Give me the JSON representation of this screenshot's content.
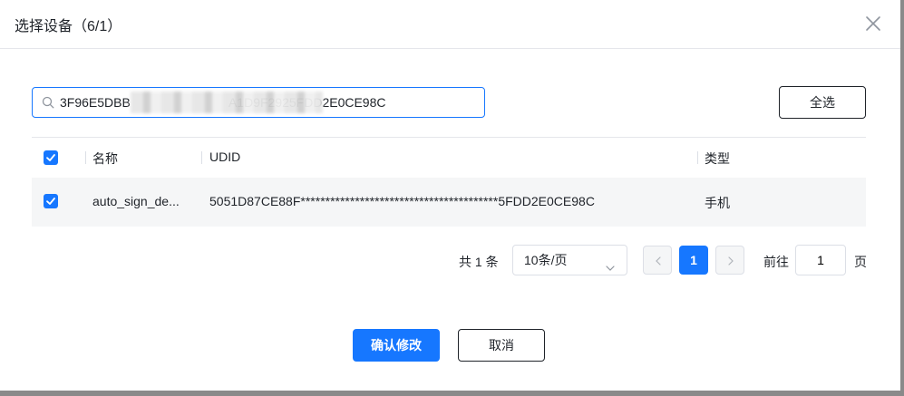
{
  "dialog": {
    "title": "选择设备（6/1）"
  },
  "search": {
    "value": "3F96E5DBB                            A1D9F2925FDD2E0CE98C",
    "placeholder": ""
  },
  "toolbar": {
    "select_all_label": "全选"
  },
  "table": {
    "columns": [
      "名称",
      "UDID",
      "类型"
    ],
    "rows": [
      {
        "checked": true,
        "name": "auto_sign_de...",
        "udid": "5051D87CE88F****************************************5FDD2E0CE98C",
        "type": "手机"
      }
    ]
  },
  "pagination": {
    "total_text": "共 1 条",
    "page_size": "10条/页",
    "current_page": "1",
    "goto_label": "前往",
    "goto_value": "1",
    "page_suffix": "页"
  },
  "footer": {
    "confirm_label": "确认修改",
    "cancel_label": "取消"
  },
  "colors": {
    "primary": "#1677ff",
    "row_bg": "#f5f6f7",
    "border": "#dcdfe6"
  }
}
